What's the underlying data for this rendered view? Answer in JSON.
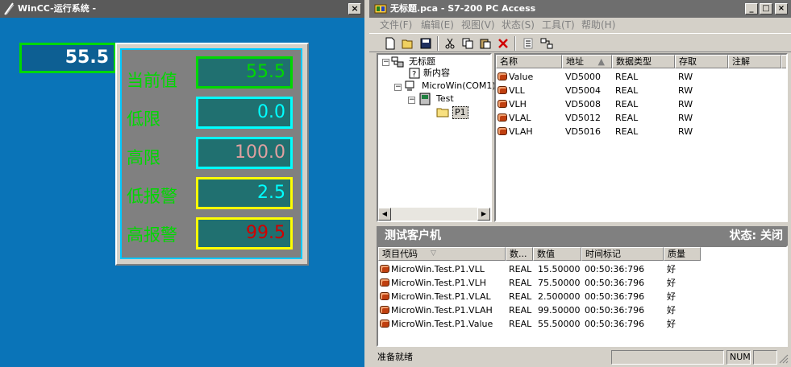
{
  "wincc": {
    "title": "WinCC-运行系统 -",
    "close_label": "×",
    "main_value": "55.5",
    "rows": [
      {
        "label": "当前值",
        "value": "55.5",
        "value_color": "#00d800",
        "border_color": "#00d800"
      },
      {
        "label": "低限",
        "value": "0.0",
        "value_color": "#00ffff",
        "border_color": "#00ffff"
      },
      {
        "label": "高限",
        "value": "100.0",
        "value_color": "#e0a0a0",
        "border_color": "#00ffff"
      },
      {
        "label": "低报警",
        "value": "2.5",
        "value_color": "#00ffff",
        "border_color": "#ffff00"
      },
      {
        "label": "高报警",
        "value": "99.5",
        "value_color": "#d00000",
        "border_color": "#ffff00"
      }
    ]
  },
  "pca": {
    "title": "无标题.pca - S7-200 PC Access",
    "caption_buttons": {
      "minimize": "_",
      "maximize": "□",
      "close": "×"
    },
    "menu": [
      "文件(F)",
      "编辑(E)",
      "视图(V)",
      "状态(S)",
      "工具(T)",
      "帮助(H)"
    ],
    "toolbar_icons": [
      "new-icon",
      "open-icon",
      "save-icon",
      "cut-icon",
      "copy-icon",
      "paste-icon",
      "delete-icon",
      "properties-icon",
      "network-icon"
    ],
    "tree": {
      "root": "无标题",
      "new_content": "新内容",
      "plc": "MicroWin(COM1)",
      "project": "Test",
      "folder": "P1"
    },
    "list": {
      "columns": [
        "名称",
        "地址",
        "数据类型",
        "存取",
        "注解"
      ],
      "rows": [
        {
          "name": "Value",
          "address": "VD5000",
          "type": "REAL",
          "access": "RW"
        },
        {
          "name": "VLL",
          "address": "VD5004",
          "type": "REAL",
          "access": "RW"
        },
        {
          "name": "VLH",
          "address": "VD5008",
          "type": "REAL",
          "access": "RW"
        },
        {
          "name": "VLAL",
          "address": "VD5012",
          "type": "REAL",
          "access": "RW"
        },
        {
          "name": "VLAH",
          "address": "VD5016",
          "type": "REAL",
          "access": "RW"
        }
      ]
    },
    "client": {
      "title": "测试客户机",
      "status": "状态: 关闭",
      "columns": [
        "项目代码",
        "数...",
        "数值",
        "时间标记",
        "质量"
      ],
      "rows": [
        {
          "item": "MicroWin.Test.P1.VLL",
          "type": "REAL",
          "value": "15.50000",
          "time": "00:50:36:796",
          "quality": "好"
        },
        {
          "item": "MicroWin.Test.P1.VLH",
          "type": "REAL",
          "value": "75.50000",
          "time": "00:50:36:796",
          "quality": "好"
        },
        {
          "item": "MicroWin.Test.P1.VLAL",
          "type": "REAL",
          "value": "2.500000",
          "time": "00:50:36:796",
          "quality": "好"
        },
        {
          "item": "MicroWin.Test.P1.VLAH",
          "type": "REAL",
          "value": "99.50000",
          "time": "00:50:36:796",
          "quality": "好"
        },
        {
          "item": "MicroWin.Test.P1.Value",
          "type": "REAL",
          "value": "55.50000",
          "time": "00:50:36:796",
          "quality": "好"
        }
      ]
    },
    "statusbar": {
      "text": "准备就绪",
      "num": "NUM"
    }
  }
}
